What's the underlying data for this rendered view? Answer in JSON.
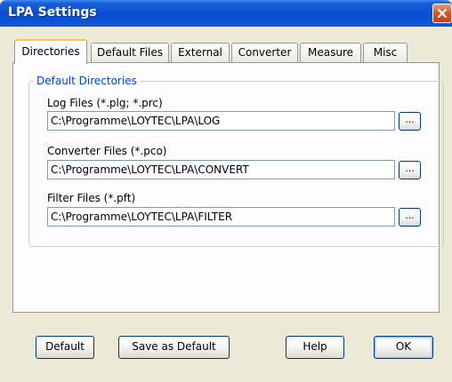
{
  "window": {
    "title": "LPA Settings"
  },
  "tabs": [
    {
      "label": "Directories",
      "active": true
    },
    {
      "label": "Default Files",
      "active": false
    },
    {
      "label": "External",
      "active": false
    },
    {
      "label": "Converter",
      "active": false
    },
    {
      "label": "Measure",
      "active": false
    },
    {
      "label": "Misc",
      "active": false
    }
  ],
  "group": {
    "title": "Default Directories",
    "fields": [
      {
        "label": "Log Files (*.plg; *.prc)",
        "value": "C:\\Programme\\LOYTEC\\LPA\\LOG",
        "browse": "..."
      },
      {
        "label": "Converter Files (*.pco)",
        "value": "C:\\Programme\\LOYTEC\\LPA\\CONVERT",
        "browse": "..."
      },
      {
        "label": "Filter Files (*.pft)",
        "value": "C:\\Programme\\LOYTEC\\LPA\\FILTER",
        "browse": "..."
      }
    ]
  },
  "buttons": {
    "default": "Default",
    "save_default": "Save as Default",
    "help": "Help",
    "ok": "OK"
  },
  "colors": {
    "titlebar": "#0a4fcf",
    "dialog": "#ece9d8",
    "group_title": "#0046d5",
    "close": "#d8582f"
  }
}
